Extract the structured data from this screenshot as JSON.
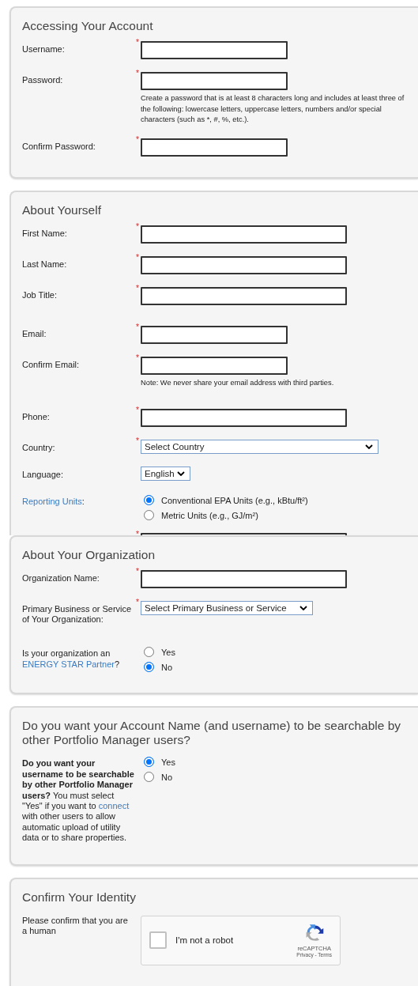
{
  "panels": [
    {
      "title": "Accessing Your Account",
      "clip": false,
      "groups": [
        [
          {
            "kind": "text_short",
            "label": "Username:",
            "marker": "*"
          },
          {
            "kind": "text_short",
            "label": "Password:",
            "marker": "*",
            "note": "Create a password that is at least 8 characters long and includes at least three of the following: lowercase letters, uppercase letters, numbers and/or special characters (such as *, #, %, etc.)."
          },
          {
            "kind": "text_short",
            "label": "Confirm Password:",
            "marker": "*"
          }
        ]
      ]
    },
    {
      "title": "About Yourself",
      "clip": true,
      "groups": [
        [
          {
            "kind": "text_long",
            "label": "First Name:",
            "marker": "*"
          },
          {
            "kind": "text_long",
            "label": "Last Name:",
            "marker": "*"
          },
          {
            "kind": "text_long",
            "label": "Job Title:",
            "marker": "*"
          }
        ],
        [
          {
            "kind": "text_short",
            "label": "Email:",
            "marker": "*"
          },
          {
            "kind": "text_short",
            "label": "Confirm Email:",
            "marker": "*",
            "note": "Note: We never share your email address with third parties."
          }
        ],
        [
          {
            "kind": "text_long",
            "label": "Phone:",
            "marker": "*"
          },
          {
            "kind": "select_full",
            "label": "Country:",
            "marker": "*",
            "value": "Select Country"
          },
          {
            "kind": "select_small",
            "label": "Language:",
            "value": "English"
          },
          {
            "kind": "radio",
            "label": {
              "link": "Reporting Units",
              "after": ":"
            },
            "options": [
              {
                "label": "Conventional EPA Units (e.g., kBtu/ft²)",
                "selected": true
              },
              {
                "label": "Metric Units (e.g., GJ/m²)",
                "selected": false
              }
            ]
          },
          {
            "kind": "text_long",
            "marker": "*"
          }
        ]
      ]
    },
    {
      "title": "About Your Organization",
      "clip": false,
      "groups": [
        [
          {
            "kind": "text_long",
            "label": "Organization Name:",
            "marker": "*"
          },
          {
            "kind": "select_medium",
            "label": "Primary Business or Service of Your Organization:",
            "marker": "*",
            "value": "Select Primary Business or Service"
          }
        ],
        [
          {
            "kind": "radio",
            "label": {
              "before": "Is your organization an",
              "link": "ENERGY STAR Partner",
              "after": "?"
            },
            "options": [
              {
                "label": "Yes",
                "selected": false
              },
              {
                "label": "No",
                "selected": true
              }
            ]
          }
        ]
      ]
    },
    {
      "title": "Do you want your Account Name (and username) to be searchable by other Portfolio Manager users?",
      "clip": false,
      "groups": [
        [
          {
            "kind": "radio",
            "label": {
              "before": "**Do you want your username to be searchable by other Portfolio Manager users?** You must select \"Yes\" if you want to",
              "link": "connect",
              "after": "with other users to allow automatic upload of utility data or to share properties."
            },
            "options": [
              {
                "label": "Yes",
                "selected": true
              },
              {
                "label": "No",
                "selected": false
              }
            ]
          }
        ]
      ]
    },
    {
      "title": "Confirm Your Identity",
      "clip": false,
      "groups": [
        [
          {
            "kind": "captcha",
            "label": "Please confirm that you are a human",
            "checked": false,
            "text": "I'm not a robot",
            "brand": "reCAPTCHA",
            "links": "Privacy - Terms"
          }
        ]
      ]
    }
  ]
}
